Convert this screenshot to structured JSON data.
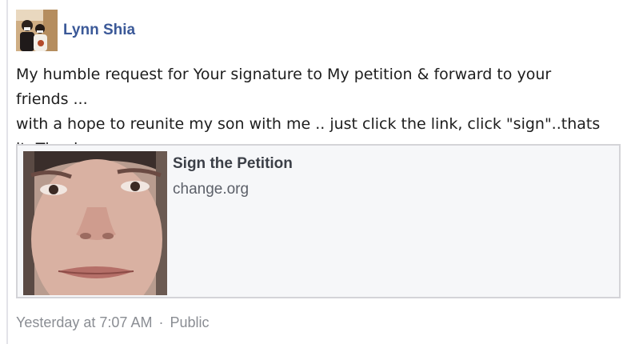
{
  "post": {
    "author": {
      "name": "Lynn Shia",
      "avatar_icon": "profile-photo"
    },
    "message_lines": [
      "My humble request for Your signature to My petition & forward to your friends ...",
      "with a hope to reunite my son with me .. just click the link, click \"sign\"..thats",
      "it..Thank you.."
    ],
    "share": {
      "title": "Sign the Petition",
      "domain": "change.org",
      "thumbnail_icon": "petition-photo"
    },
    "footer": {
      "timestamp": "Yesterday at 7:07 AM",
      "separator": "·",
      "privacy": "Public"
    }
  },
  "colors": {
    "author_link": "#3b5998",
    "card_background": "#f6f7f9",
    "card_border": "#d4d4d8",
    "footer_text": "#8a8d93"
  }
}
